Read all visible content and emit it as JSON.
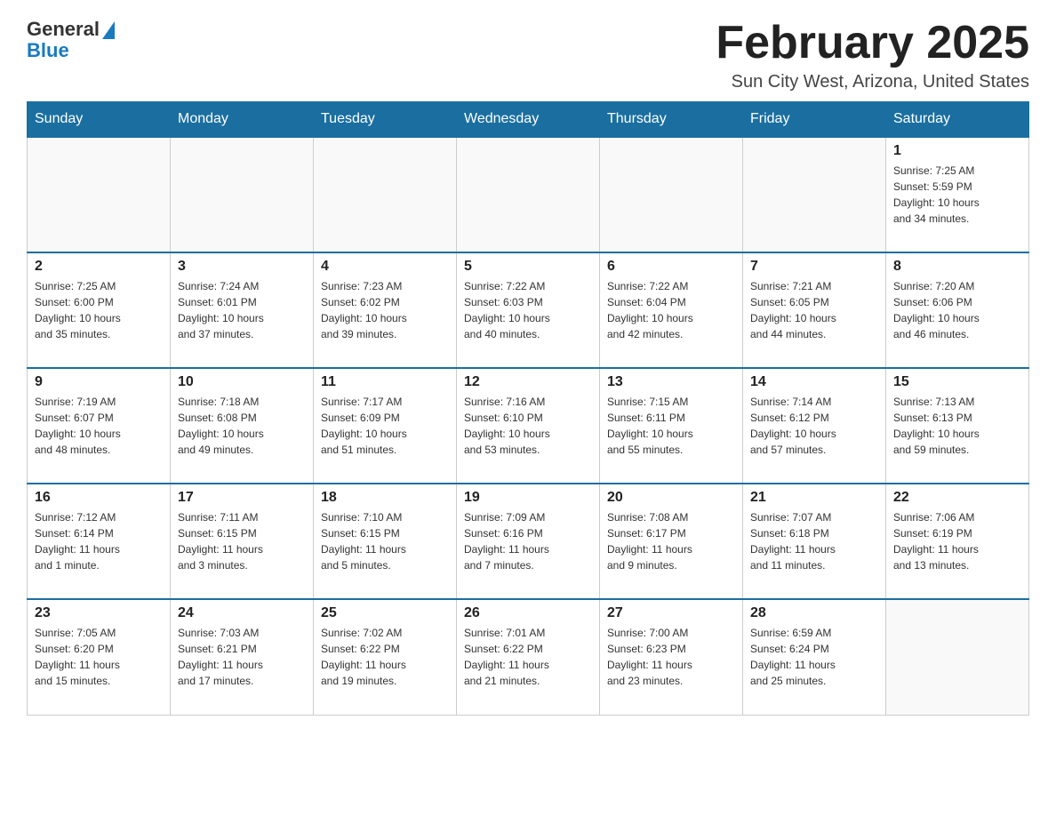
{
  "header": {
    "logo": {
      "general": "General",
      "blue": "Blue"
    },
    "title": "February 2025",
    "location": "Sun City West, Arizona, United States"
  },
  "weekdays": [
    "Sunday",
    "Monday",
    "Tuesday",
    "Wednesday",
    "Thursday",
    "Friday",
    "Saturday"
  ],
  "weeks": [
    [
      {
        "day": "",
        "info": ""
      },
      {
        "day": "",
        "info": ""
      },
      {
        "day": "",
        "info": ""
      },
      {
        "day": "",
        "info": ""
      },
      {
        "day": "",
        "info": ""
      },
      {
        "day": "",
        "info": ""
      },
      {
        "day": "1",
        "info": "Sunrise: 7:25 AM\nSunset: 5:59 PM\nDaylight: 10 hours\nand 34 minutes."
      }
    ],
    [
      {
        "day": "2",
        "info": "Sunrise: 7:25 AM\nSunset: 6:00 PM\nDaylight: 10 hours\nand 35 minutes."
      },
      {
        "day": "3",
        "info": "Sunrise: 7:24 AM\nSunset: 6:01 PM\nDaylight: 10 hours\nand 37 minutes."
      },
      {
        "day": "4",
        "info": "Sunrise: 7:23 AM\nSunset: 6:02 PM\nDaylight: 10 hours\nand 39 minutes."
      },
      {
        "day": "5",
        "info": "Sunrise: 7:22 AM\nSunset: 6:03 PM\nDaylight: 10 hours\nand 40 minutes."
      },
      {
        "day": "6",
        "info": "Sunrise: 7:22 AM\nSunset: 6:04 PM\nDaylight: 10 hours\nand 42 minutes."
      },
      {
        "day": "7",
        "info": "Sunrise: 7:21 AM\nSunset: 6:05 PM\nDaylight: 10 hours\nand 44 minutes."
      },
      {
        "day": "8",
        "info": "Sunrise: 7:20 AM\nSunset: 6:06 PM\nDaylight: 10 hours\nand 46 minutes."
      }
    ],
    [
      {
        "day": "9",
        "info": "Sunrise: 7:19 AM\nSunset: 6:07 PM\nDaylight: 10 hours\nand 48 minutes."
      },
      {
        "day": "10",
        "info": "Sunrise: 7:18 AM\nSunset: 6:08 PM\nDaylight: 10 hours\nand 49 minutes."
      },
      {
        "day": "11",
        "info": "Sunrise: 7:17 AM\nSunset: 6:09 PM\nDaylight: 10 hours\nand 51 minutes."
      },
      {
        "day": "12",
        "info": "Sunrise: 7:16 AM\nSunset: 6:10 PM\nDaylight: 10 hours\nand 53 minutes."
      },
      {
        "day": "13",
        "info": "Sunrise: 7:15 AM\nSunset: 6:11 PM\nDaylight: 10 hours\nand 55 minutes."
      },
      {
        "day": "14",
        "info": "Sunrise: 7:14 AM\nSunset: 6:12 PM\nDaylight: 10 hours\nand 57 minutes."
      },
      {
        "day": "15",
        "info": "Sunrise: 7:13 AM\nSunset: 6:13 PM\nDaylight: 10 hours\nand 59 minutes."
      }
    ],
    [
      {
        "day": "16",
        "info": "Sunrise: 7:12 AM\nSunset: 6:14 PM\nDaylight: 11 hours\nand 1 minute."
      },
      {
        "day": "17",
        "info": "Sunrise: 7:11 AM\nSunset: 6:15 PM\nDaylight: 11 hours\nand 3 minutes."
      },
      {
        "day": "18",
        "info": "Sunrise: 7:10 AM\nSunset: 6:15 PM\nDaylight: 11 hours\nand 5 minutes."
      },
      {
        "day": "19",
        "info": "Sunrise: 7:09 AM\nSunset: 6:16 PM\nDaylight: 11 hours\nand 7 minutes."
      },
      {
        "day": "20",
        "info": "Sunrise: 7:08 AM\nSunset: 6:17 PM\nDaylight: 11 hours\nand 9 minutes."
      },
      {
        "day": "21",
        "info": "Sunrise: 7:07 AM\nSunset: 6:18 PM\nDaylight: 11 hours\nand 11 minutes."
      },
      {
        "day": "22",
        "info": "Sunrise: 7:06 AM\nSunset: 6:19 PM\nDaylight: 11 hours\nand 13 minutes."
      }
    ],
    [
      {
        "day": "23",
        "info": "Sunrise: 7:05 AM\nSunset: 6:20 PM\nDaylight: 11 hours\nand 15 minutes."
      },
      {
        "day": "24",
        "info": "Sunrise: 7:03 AM\nSunset: 6:21 PM\nDaylight: 11 hours\nand 17 minutes."
      },
      {
        "day": "25",
        "info": "Sunrise: 7:02 AM\nSunset: 6:22 PM\nDaylight: 11 hours\nand 19 minutes."
      },
      {
        "day": "26",
        "info": "Sunrise: 7:01 AM\nSunset: 6:22 PM\nDaylight: 11 hours\nand 21 minutes."
      },
      {
        "day": "27",
        "info": "Sunrise: 7:00 AM\nSunset: 6:23 PM\nDaylight: 11 hours\nand 23 minutes."
      },
      {
        "day": "28",
        "info": "Sunrise: 6:59 AM\nSunset: 6:24 PM\nDaylight: 11 hours\nand 25 minutes."
      },
      {
        "day": "",
        "info": ""
      }
    ]
  ]
}
